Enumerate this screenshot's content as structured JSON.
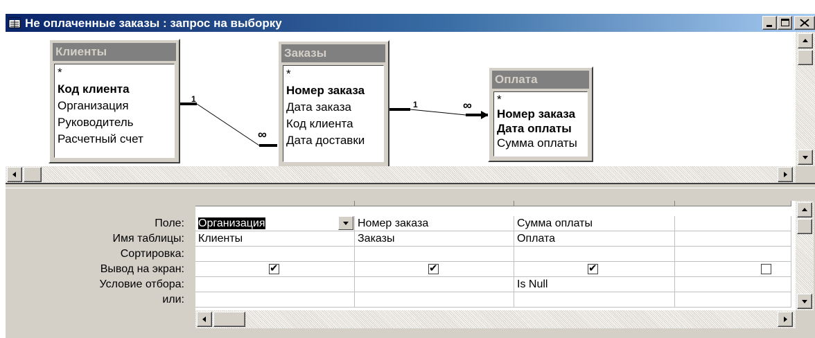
{
  "window": {
    "title": "Не оплаченные заказы : запрос на выборку",
    "icon": "query-icon",
    "controls": [
      "minimize-icon",
      "maximize-icon",
      "close-icon"
    ]
  },
  "tables": [
    {
      "title": "Клиенты",
      "fields": [
        {
          "name": "*",
          "key": false
        },
        {
          "name": "Код клиента",
          "key": true
        },
        {
          "name": "Организация",
          "key": false
        },
        {
          "name": "Руководитель",
          "key": false
        },
        {
          "name": "Расчетный счет",
          "key": false
        }
      ]
    },
    {
      "title": "Заказы",
      "fields": [
        {
          "name": "*",
          "key": false
        },
        {
          "name": "Номер заказа",
          "key": true
        },
        {
          "name": "Дата заказа",
          "key": false
        },
        {
          "name": "Код клиента",
          "key": false
        },
        {
          "name": "Дата доставки",
          "key": false
        }
      ]
    },
    {
      "title": "Оплата",
      "fields": [
        {
          "name": "*",
          "key": false
        },
        {
          "name": "Номер заказа",
          "key": true
        },
        {
          "name": "Дата оплаты",
          "key": true
        },
        {
          "name": "Сумма оплаты",
          "key": false
        }
      ]
    }
  ],
  "relations": [
    {
      "one": "1",
      "many": "∞"
    },
    {
      "one": "1",
      "many": "∞"
    }
  ],
  "grid": {
    "row_labels": {
      "field": "Поле:",
      "table": "Имя таблицы:",
      "sort": "Сортировка:",
      "show": "Вывод на экран:",
      "criteria": "Условие отбора:",
      "or": "или:"
    },
    "columns": [
      {
        "field": "Организация",
        "table": "Клиенты",
        "sort": "",
        "show": true,
        "criteria": "",
        "or": ""
      },
      {
        "field": "Номер заказа",
        "table": "Заказы",
        "sort": "",
        "show": true,
        "criteria": "",
        "or": ""
      },
      {
        "field": "Сумма оплаты",
        "table": "Оплата",
        "sort": "",
        "show": true,
        "criteria": "Is Null",
        "or": ""
      },
      {
        "field": "",
        "table": "",
        "sort": "",
        "show": false,
        "criteria": "",
        "or": ""
      }
    ],
    "checkmark": "✔"
  }
}
